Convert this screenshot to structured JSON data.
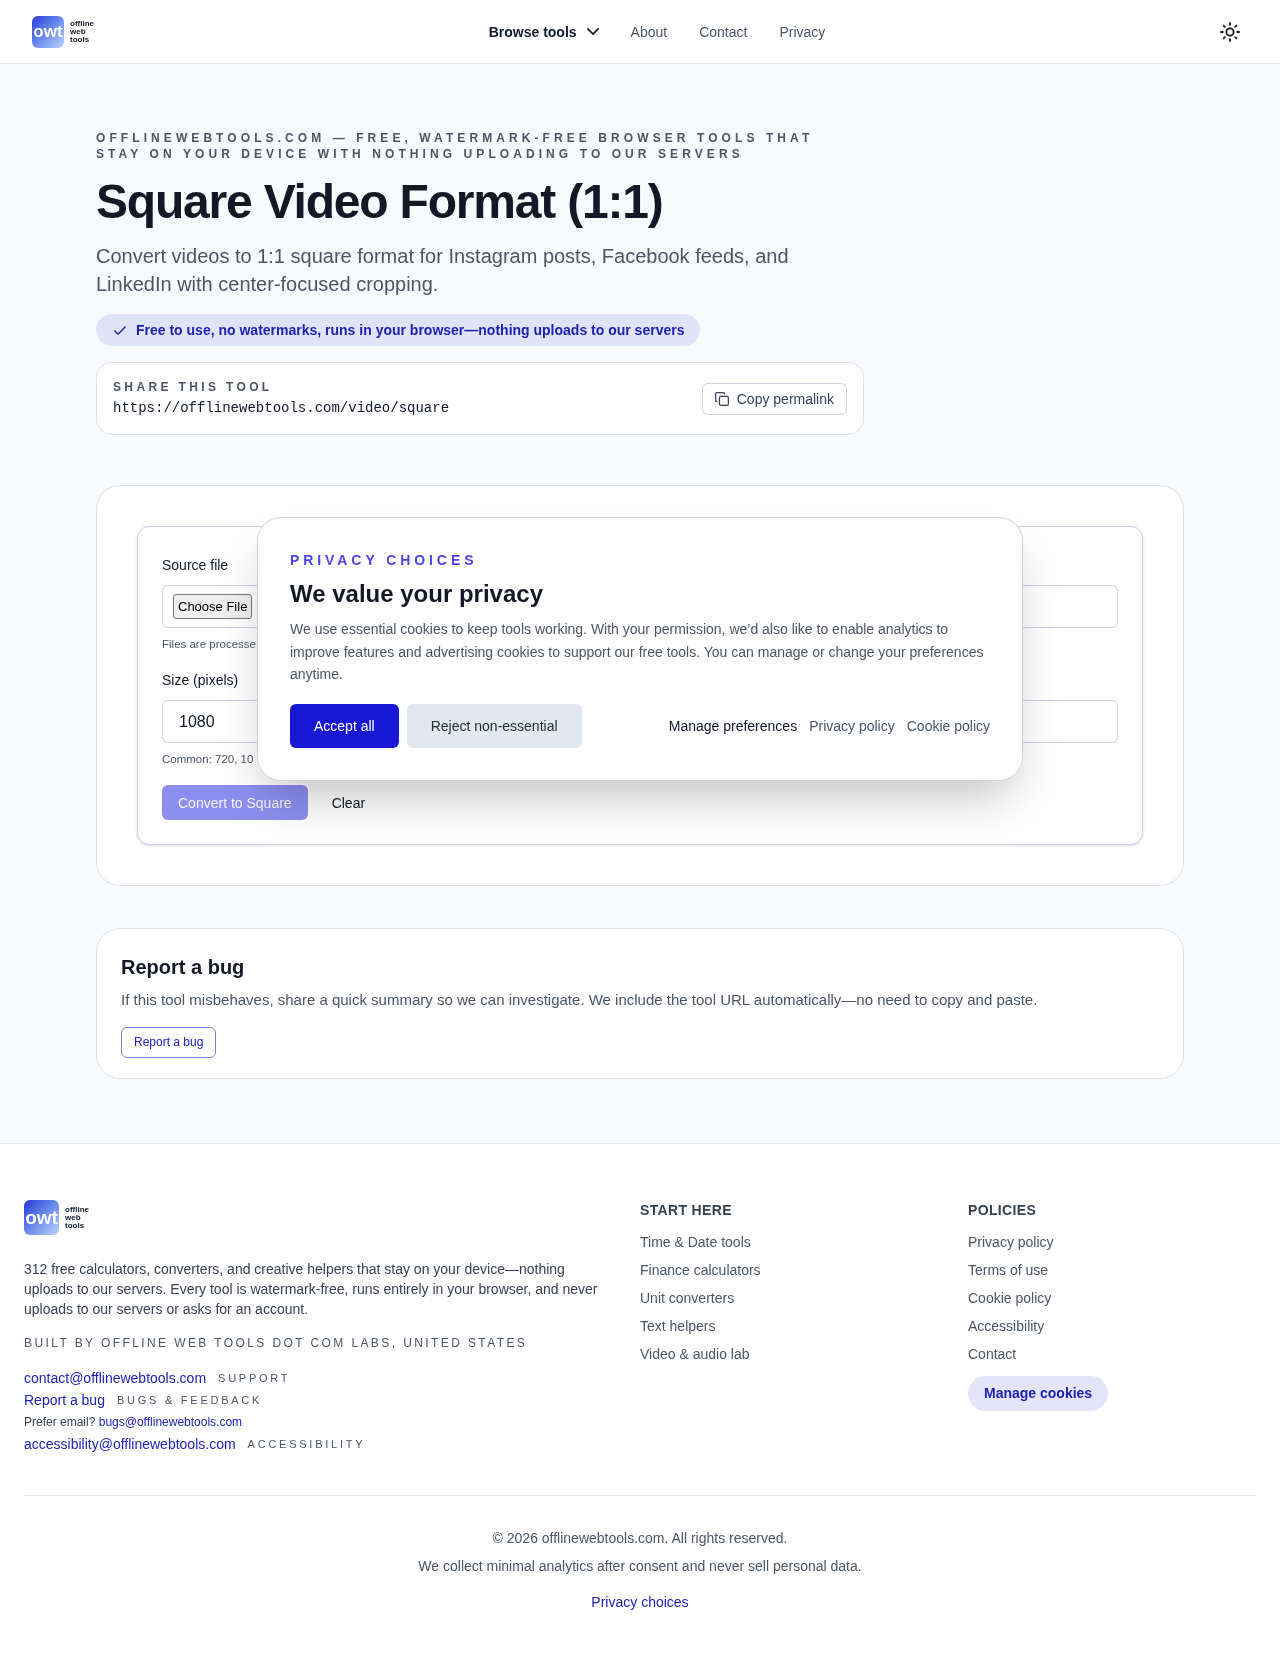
{
  "header": {
    "logo": {
      "mark": "owt",
      "wordmark": [
        "offline",
        "web",
        "tools"
      ]
    },
    "nav": [
      {
        "label": "Browse tools",
        "kind": "menu"
      },
      {
        "label": "About",
        "kind": "link"
      },
      {
        "label": "Contact",
        "kind": "link"
      },
      {
        "label": "Privacy",
        "kind": "link"
      }
    ]
  },
  "hero": {
    "eyebrow": "OFFLINEWEBTOOLS.COM — FREE, WATERMARK-FREE BROWSER TOOLS THAT STAY ON YOUR DEVICE WITH NOTHING UPLOADING TO OUR SERVERS",
    "title": "Square Video Format (1:1)",
    "description": "Convert videos to 1:1 square format for Instagram posts, Facebook feeds, and LinkedIn with center-focused cropping.",
    "badge": "Free to use, no watermarks, runs in your browser—nothing uploads to our servers"
  },
  "share": {
    "label": "SHARE THIS TOOL",
    "url": "https://offlinewebtools.com/video/square",
    "button": "Copy permalink"
  },
  "tool": {
    "source_label": "Source file",
    "file_button": "Choose File",
    "file_hint": "Files are processe",
    "size_label": "Size (pixels)",
    "size_value": "1080",
    "size_hint": "Common: 720, 10",
    "actions": [
      {
        "label": "Convert to Square",
        "kind": "primary",
        "disabled": true
      },
      {
        "label": "Clear",
        "kind": "ghost",
        "disabled": false
      }
    ]
  },
  "consent": {
    "eyebrow": "PRIVACY CHOICES",
    "title": "We value your privacy",
    "body": "We use essential cookies to keep tools working. With your permission, we’d also like to enable analytics to improve features and advertising cookies to support our free tools. You can manage or change your preferences anytime.",
    "buttons": [
      {
        "label": "Accept all",
        "kind": "primary"
      },
      {
        "label": "Reject non-essential",
        "kind": "secondary"
      }
    ],
    "links": [
      {
        "label": "Manage preferences",
        "emphasis": true
      },
      {
        "label": "Privacy policy",
        "emphasis": false
      },
      {
        "label": "Cookie policy",
        "emphasis": false
      }
    ]
  },
  "report": {
    "title": "Report a bug",
    "description": "If this tool misbehaves, share a quick summary so we can investigate. We include the tool URL automatically—no need to copy and paste.",
    "button": "Report a bug"
  },
  "footer": {
    "logo": {
      "mark": "owt",
      "wordmark": [
        "offline",
        "web",
        "tools"
      ]
    },
    "about": "312 free calculators, converters, and creative helpers that stay on your device—nothing uploads to our servers. Every tool is watermark-free, runs entirely in your browser, and never uploads to our servers or asks for an account.",
    "built_by": "BUILT BY OFFLINE WEB TOOLS DOT COM LABS, UNITED STATES",
    "contacts": [
      {
        "kind": "email",
        "link": "contact@offlinewebtools.com",
        "tag": "SUPPORT"
      },
      {
        "kind": "report",
        "link": "Report a bug",
        "tag": "BUGS & FEEDBACK"
      },
      {
        "kind": "note",
        "text": "Prefer email?",
        "link": "bugs@offlinewebtools.com"
      },
      {
        "kind": "email",
        "link": "accessibility@offlinewebtools.com",
        "tag": "ACCESSIBILITY"
      }
    ],
    "columns": [
      {
        "heading": "START HERE",
        "links": [
          "Time & Date tools",
          "Finance calculators",
          "Unit converters",
          "Text helpers",
          "Video & audio lab"
        ]
      },
      {
        "heading": "POLICIES",
        "links": [
          "Privacy policy",
          "Terms of use",
          "Cookie policy",
          "Accessibility",
          "Contact"
        ],
        "button": "Manage cookies"
      }
    ],
    "copyright": "© 2026 offlinewebtools.com. All rights reserved.",
    "analytics_note": "We collect minimal analytics after consent and never sell personal data.",
    "privacy_link": "Privacy choices"
  }
}
